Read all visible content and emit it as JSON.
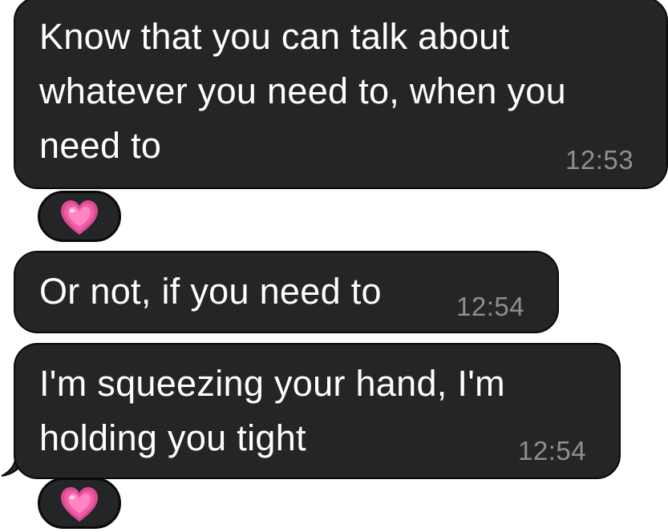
{
  "messages": [
    {
      "text_lines": [
        "Know that you can talk about",
        "whatever you need to, when you",
        "need to"
      ],
      "time": "12:53",
      "reaction": "growing-heart"
    },
    {
      "text_lines": [
        "Or not, if you need to"
      ],
      "time": "12:54"
    },
    {
      "text_lines": [
        "I'm squeezing your hand, I'm",
        "holding you tight"
      ],
      "time": "12:54",
      "reaction": "growing-heart"
    }
  ],
  "colors": {
    "bubble": "#232526",
    "text": "#ffffff",
    "time": "#8e8f91",
    "heart": "#f25aa8",
    "background": "#ffffff"
  }
}
